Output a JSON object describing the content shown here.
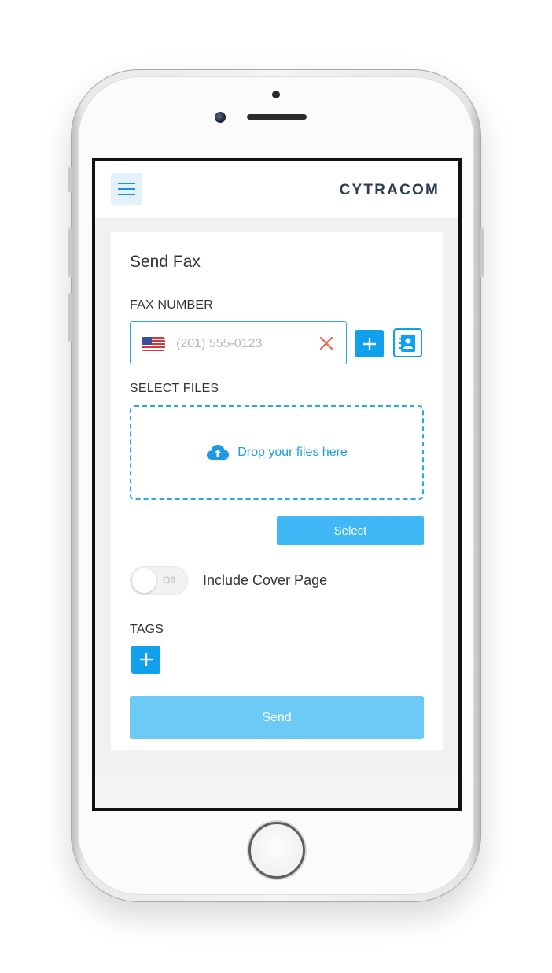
{
  "header": {
    "logo_text": "CYTRACOM",
    "menu_icon": "hamburger-menu-icon"
  },
  "form": {
    "title": "Send Fax",
    "fax_number": {
      "label": "FAX NUMBER",
      "country_flag": "us-flag-icon",
      "placeholder": "(201) 555-0123",
      "value": "",
      "clear_icon": "close-icon",
      "add_icon": "plus-icon",
      "contacts_icon": "contact-book-icon"
    },
    "select_files": {
      "label": "SELECT FILES",
      "drop_text": "Drop your files here",
      "drop_icon": "cloud-upload-icon",
      "select_label": "Select"
    },
    "cover_page": {
      "toggle_state": "Off",
      "label": "Include Cover Page"
    },
    "tags": {
      "label": "TAGS",
      "add_icon": "plus-icon"
    },
    "send_label": "Send"
  },
  "colors": {
    "accent": "#10a0ec",
    "select_button": "#3fb8f5",
    "send_button": "#6ccaf7",
    "clear_icon": "#f0674f",
    "logo": "#2e3d52"
  }
}
